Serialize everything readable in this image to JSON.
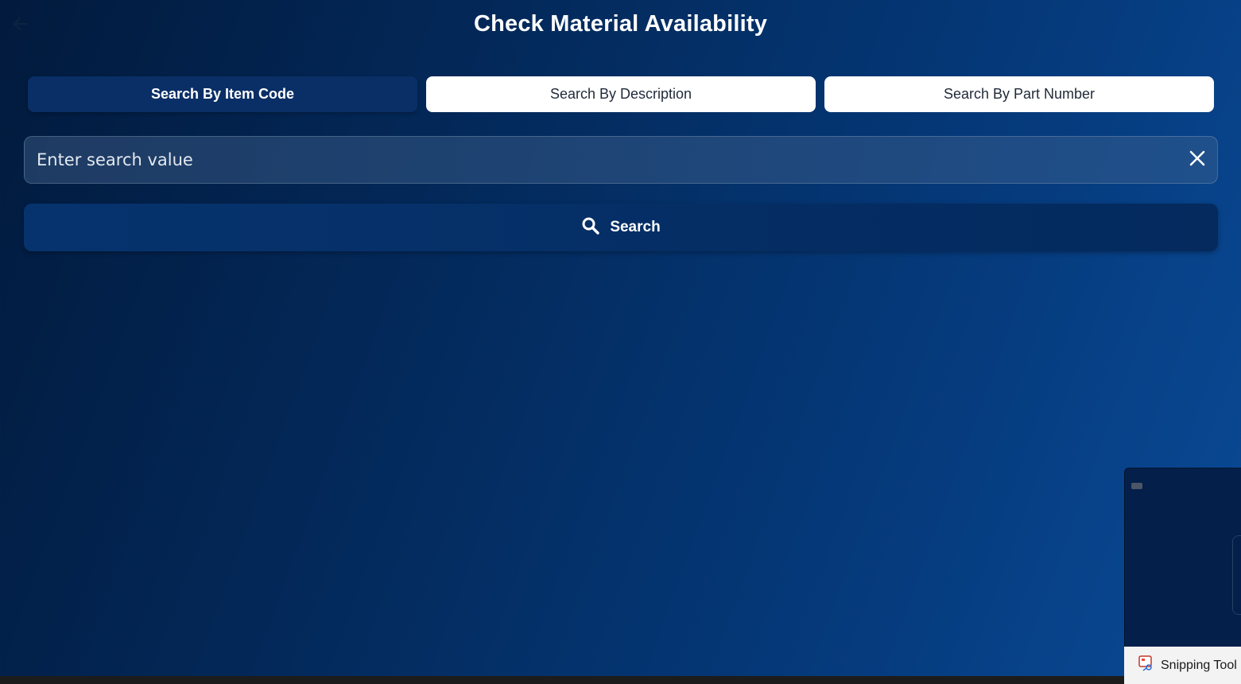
{
  "page": {
    "title": "Check Material Availability"
  },
  "tabs": [
    {
      "label": "Search By Item Code",
      "active": true
    },
    {
      "label": "Search By Description",
      "active": false
    },
    {
      "label": "Search By Part Number",
      "active": false
    }
  ],
  "search": {
    "value": "",
    "placeholder": "Enter search value",
    "button_label": "Search"
  },
  "icons": {
    "back": "arrow-left-icon",
    "clear": "close-icon",
    "search": "search-icon",
    "taskbar_app": "snipping-tool-icon"
  },
  "taskbar": {
    "app_label": "Snipping Tool"
  },
  "colors": {
    "active_tab": "#0a2f66",
    "inactive_tab": "#ffffff",
    "search_button": "#06336e",
    "background_start": "#021a3d",
    "background_end": "#0a4a96"
  }
}
